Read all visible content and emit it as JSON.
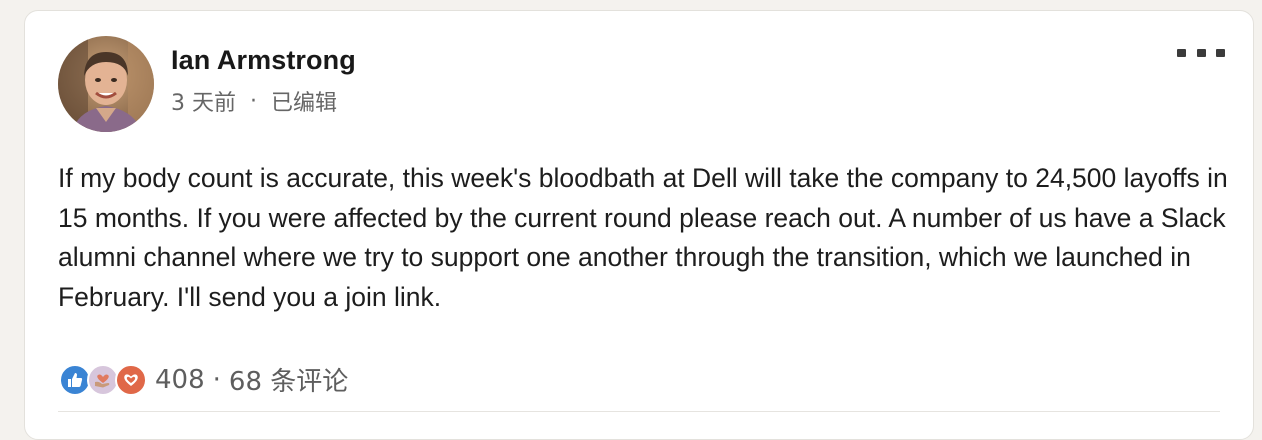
{
  "post": {
    "author_name": "Ian Armstrong",
    "time_label": "3 天前",
    "separator": "·",
    "edited_label": "已编辑",
    "body": "If my body count is accurate, this week's bloodbath at Dell will take the company to 24,500 layoffs in 15 months. If you were affected by the current round please reach out. A number of us have a Slack alumni channel where we try to support one another through the transition, which we launched in February. I'll send you a join link.",
    "reaction_count": "408",
    "counts_separator": "·",
    "comments_label": "68 条评论"
  },
  "icons": {
    "more": "more-horizontal-icon",
    "reactions": [
      "like-icon",
      "support-icon",
      "love-icon"
    ]
  },
  "colors": {
    "like": "#3a84d4",
    "support": "#d7c6dc",
    "love": "#e06848"
  }
}
